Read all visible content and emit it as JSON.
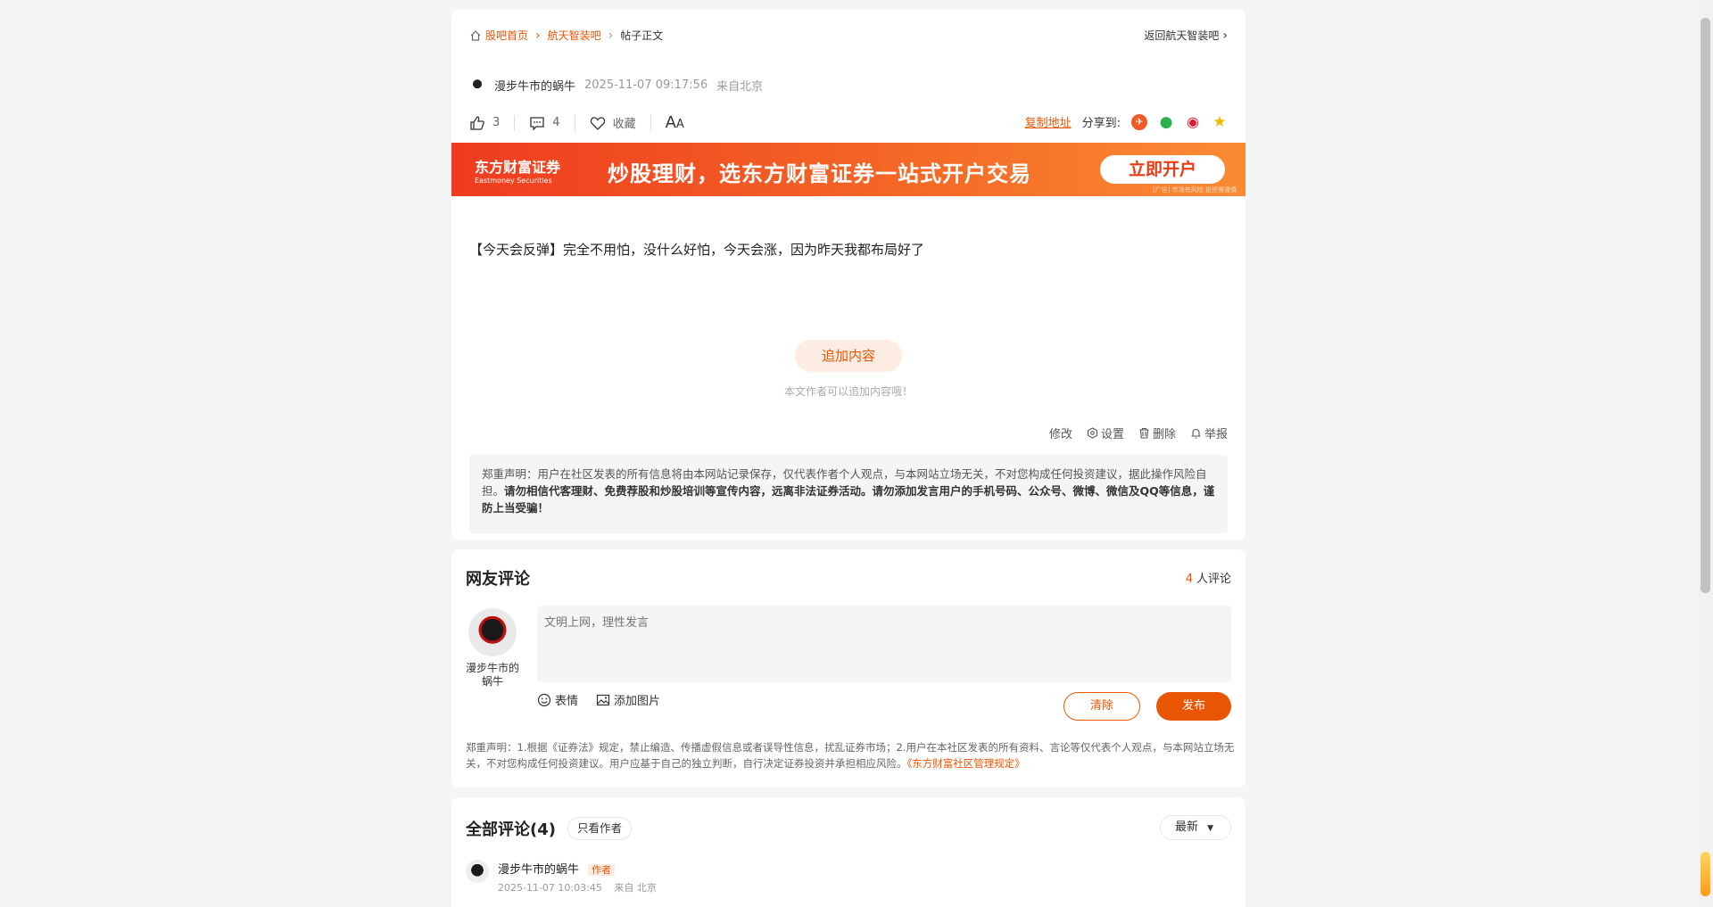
{
  "breadcrumb": {
    "home": "股吧首页",
    "bar": "航天智装吧",
    "current": "帖子正文"
  },
  "back_label": "返回航天智装吧",
  "post": {
    "author": "漫步牛市的蜗牛",
    "time": "2025-11-07 09:17:56",
    "location": "来自北京",
    "likes": "3",
    "comments": "4",
    "favorite_label": "收藏",
    "font_big": "A",
    "font_small": "A",
    "copy_label": "复制地址",
    "share_label": "分享到:",
    "content": "【今天会反弹】完全不用怕，没什么好怕，今天会涨，因为昨天我都布局好了",
    "add_label": "追加内容",
    "add_hint": "本文作者可以追加内容哦！",
    "ops": {
      "edit": "修改",
      "settings": "设置",
      "delete": "删除",
      "report": "举报"
    },
    "disclaimer_normal": "郑重声明：用户在社区发表的所有信息将由本网站记录保存，仅代表作者个人观点，与本网站立场无关，不对您构成任何投资建议，据此操作风险自担。",
    "disclaimer_bold": "请勿相信代客理财、免费荐股和炒股培训等宣传内容，远离非法证券活动。请勿添加发言用户的手机号码、公众号、微博、微信及QQ等信息，谨防上当受骗！"
  },
  "banner": {
    "logo": "东方财富证券",
    "logo_en": "Eastmoney Securities",
    "slogan": "炒股理财，选东方财富证券一站式开户交易",
    "button": "立即开户",
    "tag": "[广告] 市场有风险 投资需谨慎"
  },
  "comments": {
    "title": "网友评论",
    "count": "4",
    "count_suffix": "人评论",
    "user_name": "漫步牛市的蜗牛",
    "placeholder": "文明上网，理性发言",
    "emoji_label": "表情",
    "image_label": "添加图片",
    "clear_label": "清除",
    "publish_label": "发布",
    "disclaimer": "郑重声明：1.根据《证券法》规定，禁止编造、传播虚假信息或者误导性信息，扰乱证券市场；2.用户在本社区发表的所有资料、言论等仅代表个人观点，与本网站立场无关，不对您构成任何投资建议。用户应基于自己的独立判断，自行决定证券投资并承担相应风险。",
    "rules_link": "《东方财富社区管理规定》"
  },
  "all_comments": {
    "title": "全部评论(4)",
    "only_author": "只看作者",
    "sort": "最新",
    "first": {
      "name": "漫步牛市的蜗牛",
      "badge": "作者",
      "time": "2025-11-07 10:03:45",
      "location": "来自 北京"
    }
  },
  "colors": {
    "accent": "#ea5504",
    "banner": "#f04a22"
  }
}
